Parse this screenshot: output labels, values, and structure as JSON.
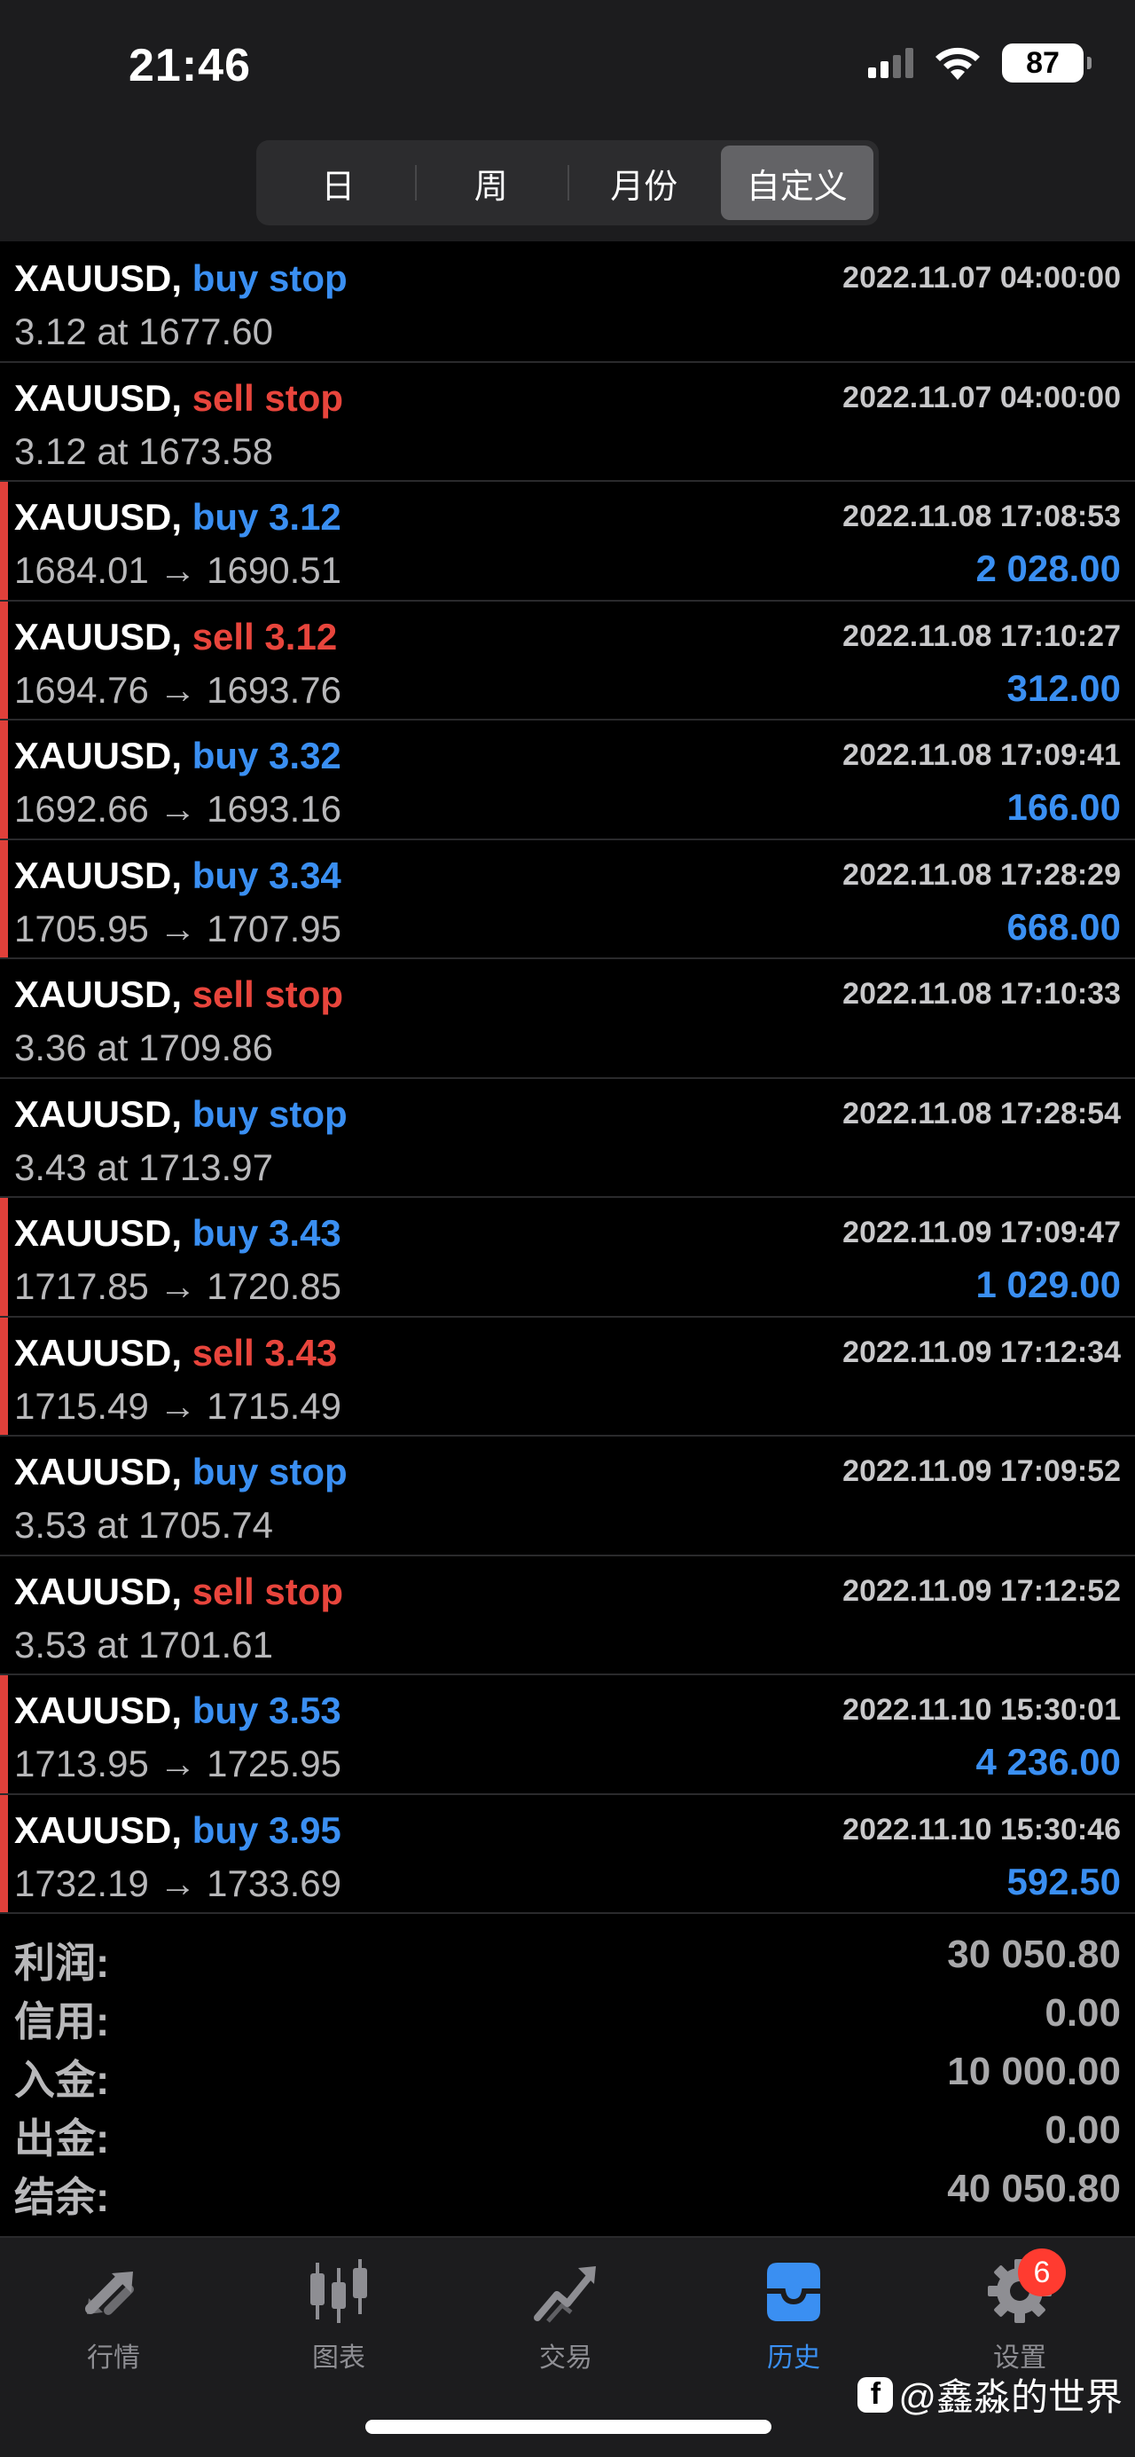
{
  "status_bar": {
    "time": "21:46",
    "battery": "87"
  },
  "segment": {
    "items": [
      {
        "label": "日"
      },
      {
        "label": "周"
      },
      {
        "label": "月份"
      },
      {
        "label": "自定义"
      }
    ],
    "selected": "自定义"
  },
  "orders": [
    {
      "symbol": "XAUUSD,",
      "action": "buy stop",
      "side": "buy",
      "detail": "3.12 at 1677.60",
      "time": "2022.11.07 04:00:00",
      "profit": ""
    },
    {
      "symbol": "XAUUSD,",
      "action": "sell stop",
      "side": "sell",
      "detail": "3.12 at 1673.58",
      "time": "2022.11.07 04:00:00",
      "profit": ""
    },
    {
      "symbol": "XAUUSD,",
      "action": "buy 3.12",
      "side": "buy",
      "detail": "1684.01 → 1690.51",
      "time": "2022.11.08 17:08:53",
      "profit": "2 028.00"
    },
    {
      "symbol": "XAUUSD,",
      "action": "sell 3.12",
      "side": "sell",
      "detail": "1694.76 → 1693.76",
      "time": "2022.11.08 17:10:27",
      "profit": "312.00"
    },
    {
      "symbol": "XAUUSD,",
      "action": "buy 3.32",
      "side": "buy",
      "detail": "1692.66 → 1693.16",
      "time": "2022.11.08 17:09:41",
      "profit": "166.00"
    },
    {
      "symbol": "XAUUSD,",
      "action": "buy 3.34",
      "side": "buy",
      "detail": "1705.95 → 1707.95",
      "time": "2022.11.08 17:28:29",
      "profit": "668.00"
    },
    {
      "symbol": "XAUUSD,",
      "action": "sell stop",
      "side": "sell",
      "detail": "3.36 at 1709.86",
      "time": "2022.11.08 17:10:33",
      "profit": ""
    },
    {
      "symbol": "XAUUSD,",
      "action": "buy stop",
      "side": "buy",
      "detail": "3.43 at 1713.97",
      "time": "2022.11.08 17:28:54",
      "profit": ""
    },
    {
      "symbol": "XAUUSD,",
      "action": "buy 3.43",
      "side": "buy",
      "detail": "1717.85 → 1720.85",
      "time": "2022.11.09 17:09:47",
      "profit": "1 029.00"
    },
    {
      "symbol": "XAUUSD,",
      "action": "sell 3.43",
      "side": "sell",
      "detail": "1715.49 → 1715.49",
      "time": "2022.11.09 17:12:34",
      "profit": ""
    },
    {
      "symbol": "XAUUSD,",
      "action": "buy stop",
      "side": "buy",
      "detail": "3.53 at 1705.74",
      "time": "2022.11.09 17:09:52",
      "profit": ""
    },
    {
      "symbol": "XAUUSD,",
      "action": "sell stop",
      "side": "sell",
      "detail": "3.53 at 1701.61",
      "time": "2022.11.09 17:12:52",
      "profit": ""
    },
    {
      "symbol": "XAUUSD,",
      "action": "buy 3.53",
      "side": "buy",
      "detail": "1713.95 → 1725.95",
      "time": "2022.11.10 15:30:01",
      "profit": "4 236.00"
    },
    {
      "symbol": "XAUUSD,",
      "action": "buy 3.95",
      "side": "buy",
      "detail": "1732.19 → 1733.69",
      "time": "2022.11.10 15:30:46",
      "profit": "592.50"
    }
  ],
  "summary": [
    {
      "label": "利润:",
      "value": "30 050.80"
    },
    {
      "label": "信用:",
      "value": "0.00"
    },
    {
      "label": "入金:",
      "value": "10 000.00"
    },
    {
      "label": "出金:",
      "value": "0.00"
    },
    {
      "label": "结余:",
      "value": "40 050.80"
    }
  ],
  "tabbar": {
    "items": [
      {
        "label": "行情",
        "icon": "quotes-arrows-icon"
      },
      {
        "label": "图表",
        "icon": "candlestick-chart-icon"
      },
      {
        "label": "交易",
        "icon": "trade-trend-icon"
      },
      {
        "label": "历史",
        "icon": "history-inbox-icon"
      },
      {
        "label": "设置",
        "icon": "gear-icon"
      }
    ],
    "active": "历史",
    "settings_badge": "6"
  },
  "watermark": {
    "logo": "f",
    "text": "@鑫淼的世界"
  },
  "colors": {
    "buy": "#3a8ff2",
    "sell": "#e8453c",
    "marker": "#e0403a",
    "badge": "#ff3b30"
  }
}
